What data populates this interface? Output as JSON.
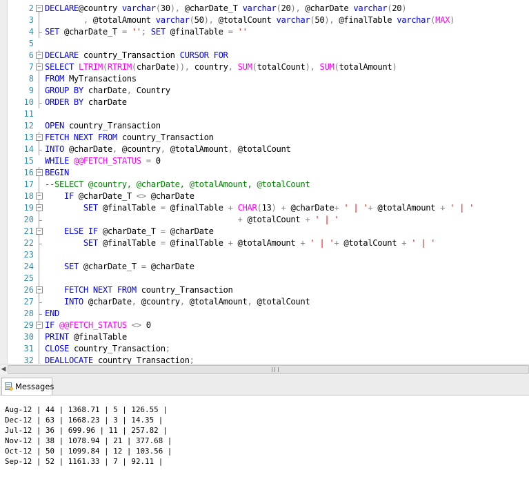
{
  "editor": {
    "lines": [
      {
        "n": "2",
        "g": "box",
        "t": [
          [
            "k",
            "DECLARE"
          ],
          [
            "",
            "@country "
          ],
          [
            "k",
            "varchar"
          ],
          [
            "g",
            "("
          ],
          [
            "",
            "30"
          ],
          [
            "g",
            ")"
          ],
          [
            "g",
            ","
          ],
          [
            "",
            " @charDate_T "
          ],
          [
            "k",
            "varchar"
          ],
          [
            "g",
            "("
          ],
          [
            "",
            "20"
          ],
          [
            "g",
            ")"
          ],
          [
            "g",
            ","
          ],
          [
            "",
            " @charDate "
          ],
          [
            "k",
            "varchar"
          ],
          [
            "g",
            "("
          ],
          [
            "",
            "20"
          ],
          [
            "g",
            ")"
          ]
        ]
      },
      {
        "n": "3",
        "g": "line",
        "t": [
          [
            "",
            "        "
          ],
          [
            "g",
            ","
          ],
          [
            "",
            " @totalAmount "
          ],
          [
            "k",
            "varchar"
          ],
          [
            "g",
            "("
          ],
          [
            "",
            "50"
          ],
          [
            "g",
            ")"
          ],
          [
            "g",
            ","
          ],
          [
            "",
            " @totalCount "
          ],
          [
            "k",
            "varchar"
          ],
          [
            "g",
            "("
          ],
          [
            "",
            "50"
          ],
          [
            "g",
            ")"
          ],
          [
            "g",
            ","
          ],
          [
            "",
            " @finalTable "
          ],
          [
            "k",
            "varchar"
          ],
          [
            "g",
            "("
          ],
          [
            "f",
            "MAX"
          ],
          [
            "g",
            ")"
          ]
        ]
      },
      {
        "n": "4",
        "g": "end",
        "t": [
          [
            "k",
            "SET"
          ],
          [
            "",
            " @charDate_T "
          ],
          [
            "g",
            "="
          ],
          [
            "",
            " "
          ],
          [
            "s",
            "''"
          ],
          [
            "g",
            ";"
          ],
          [
            "",
            " "
          ],
          [
            "k",
            "SET"
          ],
          [
            "",
            " @finalTable "
          ],
          [
            "g",
            "="
          ],
          [
            "",
            " "
          ],
          [
            "s",
            "''"
          ]
        ]
      },
      {
        "n": "5",
        "g": "none",
        "t": []
      },
      {
        "n": "6",
        "g": "box",
        "t": [
          [
            "k",
            "DECLARE"
          ],
          [
            "",
            " country_Transaction "
          ],
          [
            "k",
            "CURSOR FOR"
          ]
        ]
      },
      {
        "n": "7",
        "g": "box",
        "t": [
          [
            "k",
            "SELECT"
          ],
          [
            "",
            " "
          ],
          [
            "f",
            "LTRIM"
          ],
          [
            "g",
            "("
          ],
          [
            "f",
            "RTRIM"
          ],
          [
            "g",
            "("
          ],
          [
            "",
            "charDate"
          ],
          [
            "g",
            "))"
          ],
          [
            "g",
            ","
          ],
          [
            "",
            " country"
          ],
          [
            "g",
            ","
          ],
          [
            "",
            " "
          ],
          [
            "f",
            "SUM"
          ],
          [
            "g",
            "("
          ],
          [
            "",
            "totalCount"
          ],
          [
            "g",
            ")"
          ],
          [
            "g",
            ","
          ],
          [
            "",
            " "
          ],
          [
            "f",
            "SUM"
          ],
          [
            "g",
            "("
          ],
          [
            "",
            "totalAmount"
          ],
          [
            "g",
            ")"
          ]
        ]
      },
      {
        "n": "8",
        "g": "line",
        "t": [
          [
            "k",
            "FROM"
          ],
          [
            "",
            " MyTransactions"
          ]
        ]
      },
      {
        "n": "9",
        "g": "line",
        "t": [
          [
            "k",
            "GROUP BY"
          ],
          [
            "",
            " charDate"
          ],
          [
            "g",
            ","
          ],
          [
            "",
            " Country"
          ]
        ]
      },
      {
        "n": "10",
        "g": "end",
        "t": [
          [
            "k",
            "ORDER BY"
          ],
          [
            "",
            " charDate"
          ]
        ]
      },
      {
        "n": "11",
        "g": "none",
        "t": []
      },
      {
        "n": "12",
        "g": "none",
        "t": [
          [
            "k",
            "OPEN"
          ],
          [
            "",
            " country_Transaction"
          ]
        ]
      },
      {
        "n": "13",
        "g": "box",
        "t": [
          [
            "k",
            "FETCH NEXT FROM"
          ],
          [
            "",
            " country_Transaction"
          ]
        ]
      },
      {
        "n": "14",
        "g": "end",
        "t": [
          [
            "k",
            "INTO"
          ],
          [
            "",
            " @charDate"
          ],
          [
            "g",
            ","
          ],
          [
            "",
            " @country"
          ],
          [
            "g",
            ","
          ],
          [
            "",
            " @totalAmount"
          ],
          [
            "g",
            ","
          ],
          [
            "",
            " @totalCount"
          ]
        ]
      },
      {
        "n": "15",
        "g": "none",
        "t": [
          [
            "k",
            "WHILE"
          ],
          [
            "",
            " "
          ],
          [
            "f",
            "@@FETCH_STATUS"
          ],
          [
            "",
            " "
          ],
          [
            "g",
            "="
          ],
          [
            "",
            " 0"
          ]
        ]
      },
      {
        "n": "16",
        "g": "box",
        "t": [
          [
            "k",
            "BEGIN"
          ]
        ]
      },
      {
        "n": "17",
        "g": "line",
        "t": [
          [
            "c",
            "--SELECT @country, @charDate, @totalAmount, @totalCount"
          ]
        ]
      },
      {
        "n": "18",
        "g": "box",
        "t": [
          [
            "",
            "    "
          ],
          [
            "k",
            "IF"
          ],
          [
            "",
            " @charDate_T "
          ],
          [
            "g",
            "<>"
          ],
          [
            "",
            " @charDate"
          ]
        ]
      },
      {
        "n": "19",
        "g": "box",
        "t": [
          [
            "",
            "        "
          ],
          [
            "k",
            "SET"
          ],
          [
            "",
            " @finalTable "
          ],
          [
            "g",
            "="
          ],
          [
            "",
            " @finalTable "
          ],
          [
            "g",
            "+"
          ],
          [
            "",
            " "
          ],
          [
            "f",
            "CHAR"
          ],
          [
            "g",
            "("
          ],
          [
            "",
            "13"
          ],
          [
            "g",
            ")"
          ],
          [
            "",
            " "
          ],
          [
            "g",
            "+"
          ],
          [
            "",
            " @charDate"
          ],
          [
            "g",
            "+"
          ],
          [
            "",
            " "
          ],
          [
            "s",
            "' | '"
          ],
          [
            "g",
            "+"
          ],
          [
            "",
            " @totalAmount "
          ],
          [
            "g",
            "+"
          ],
          [
            "",
            " "
          ],
          [
            "s",
            "' | '"
          ]
        ]
      },
      {
        "n": "20",
        "g": "end",
        "t": [
          [
            "",
            "                                        "
          ],
          [
            "g",
            "+"
          ],
          [
            "",
            " @totalCount "
          ],
          [
            "g",
            "+"
          ],
          [
            "",
            " "
          ],
          [
            "s",
            "' | '"
          ]
        ]
      },
      {
        "n": "21",
        "g": "box",
        "t": [
          [
            "",
            "    "
          ],
          [
            "k",
            "ELSE IF"
          ],
          [
            "",
            " @charDate_T "
          ],
          [
            "g",
            "="
          ],
          [
            "",
            " @charDate"
          ]
        ]
      },
      {
        "n": "22",
        "g": "end",
        "t": [
          [
            "",
            "        "
          ],
          [
            "k",
            "SET"
          ],
          [
            "",
            " @finalTable "
          ],
          [
            "g",
            "="
          ],
          [
            "",
            " @finalTable "
          ],
          [
            "g",
            "+"
          ],
          [
            "",
            " @totalAmount "
          ],
          [
            "g",
            "+"
          ],
          [
            "",
            " "
          ],
          [
            "s",
            "' | '"
          ],
          [
            "g",
            "+"
          ],
          [
            "",
            " @totalCount "
          ],
          [
            "g",
            "+"
          ],
          [
            "",
            " "
          ],
          [
            "s",
            "' | '"
          ]
        ]
      },
      {
        "n": "23",
        "g": "line",
        "t": []
      },
      {
        "n": "24",
        "g": "line",
        "t": [
          [
            "",
            "    "
          ],
          [
            "k",
            "SET"
          ],
          [
            "",
            " @charDate_T "
          ],
          [
            "g",
            "="
          ],
          [
            "",
            " @charDate"
          ]
        ]
      },
      {
        "n": "25",
        "g": "line",
        "t": []
      },
      {
        "n": "26",
        "g": "box",
        "t": [
          [
            "",
            "    "
          ],
          [
            "k",
            "FETCH NEXT FROM"
          ],
          [
            "",
            " country_Transaction"
          ]
        ]
      },
      {
        "n": "27",
        "g": "end",
        "t": [
          [
            "",
            "    "
          ],
          [
            "k",
            "INTO"
          ],
          [
            "",
            " @charDate"
          ],
          [
            "g",
            ","
          ],
          [
            "",
            " @country"
          ],
          [
            "g",
            ","
          ],
          [
            "",
            " @totalAmount"
          ],
          [
            "g",
            ","
          ],
          [
            "",
            " @totalCount"
          ]
        ]
      },
      {
        "n": "28",
        "g": "end",
        "t": [
          [
            "k",
            "END"
          ]
        ]
      },
      {
        "n": "29",
        "g": "box",
        "t": [
          [
            "k",
            "IF"
          ],
          [
            "",
            " "
          ],
          [
            "f",
            "@@FETCH_STATUS"
          ],
          [
            "",
            " "
          ],
          [
            "g",
            "<>"
          ],
          [
            "",
            " 0"
          ]
        ]
      },
      {
        "n": "30",
        "g": "line",
        "t": [
          [
            "k",
            "PRINT"
          ],
          [
            "",
            " @finalTable"
          ]
        ]
      },
      {
        "n": "31",
        "g": "line",
        "t": [
          [
            "k",
            "CLOSE"
          ],
          [
            "",
            " country_Transaction"
          ],
          [
            "g",
            ";"
          ]
        ]
      },
      {
        "n": "32",
        "g": "line",
        "t": [
          [
            "k",
            "DEALLOCATE"
          ],
          [
            "",
            " country_Transaction"
          ],
          [
            "g",
            ";"
          ]
        ]
      }
    ]
  },
  "results": {
    "tab_label": "Messages",
    "icon": "messages-icon",
    "lines": [
      "Aug-12 | 44 | 1368.71 | 5 | 126.55 |",
      "Dec-12 | 63 | 1668.23 | 3 | 14.35 |",
      "Jul-12 | 36 | 699.96 | 11 | 257.82 |",
      "Nov-12 | 38 | 1078.94 | 21 | 377.68 |",
      "Oct-12 | 50 | 1099.84 | 12 | 103.56 |",
      "Sep-12 | 52 | 1161.33 | 7 | 92.11 |"
    ]
  },
  "colors": {
    "keyword": "#0000ff",
    "function": "#ff00ff",
    "string": "#ff0000",
    "operator": "#808080",
    "comment": "#008000",
    "line_number": "#2b91af"
  }
}
